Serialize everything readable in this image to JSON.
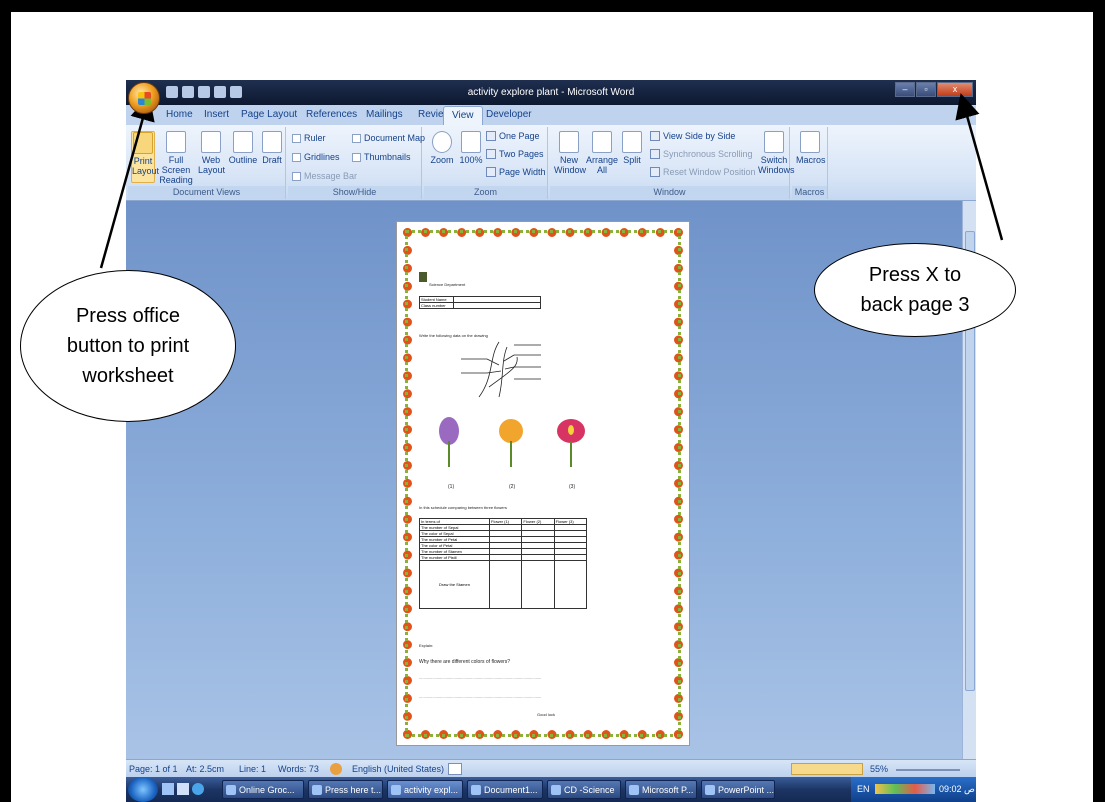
{
  "window": {
    "title": "activity explore plant - Microsoft Word",
    "controls": [
      "–",
      "▫",
      "x"
    ]
  },
  "tabs": [
    "Home",
    "Insert",
    "Page Layout",
    "References",
    "Mailings",
    "Review",
    "View",
    "Developer"
  ],
  "active_tab": "View",
  "ribbon": {
    "document_views": {
      "label": "Document Views",
      "print_layout": "Print Layout",
      "print": "Print",
      "layout": "Layout",
      "full_screen": "Full Screen",
      "reading": "Reading",
      "web": "Web",
      "web_layout": "Layout",
      "outline": "Outline",
      "draft": "Draft"
    },
    "show_hide": {
      "label": "Show/Hide",
      "ruler": "Ruler",
      "gridlines": "Gridlines",
      "message_bar": "Message Bar",
      "document_map": "Document Map",
      "thumbnails": "Thumbnails"
    },
    "zoom": {
      "label": "Zoom",
      "zoom": "Zoom",
      "hundred": "100%",
      "one_page": "One Page",
      "two_pages": "Two Pages",
      "page_width": "Page Width"
    },
    "window": {
      "label": "Window",
      "new_window": "New",
      "new_window2": "Window",
      "arrange": "Arrange",
      "arrange2": "All",
      "split": "Split",
      "view_side": "View Side by Side",
      "sync_scroll": "Synchronous Scrolling",
      "reset_pos": "Reset Window Position",
      "switch": "Switch",
      "switch2": "Windows"
    },
    "macros": {
      "label": "Macros",
      "macros": "Macros"
    }
  },
  "document": {
    "header": "Science Department",
    "student_name": "Student Name",
    "class_number": "Class number",
    "instruction": "Write the following data on the drawing",
    "flower_labels": [
      "(1)",
      "(2)",
      "(3)"
    ],
    "bullet": "In this schedule comparing between three flowers",
    "table_headers": [
      "In terms of",
      "Flower (1)",
      "Flower (2)",
      "Flower (3)"
    ],
    "table_rows": [
      "The number of Sepal",
      "The color of Sepal",
      "The number of Petal",
      "The color of Petal",
      "The number of Stamen",
      "The number of Pistil"
    ],
    "draw_row": "Draw the Stamen",
    "explain": "Explain:",
    "question": "Why there are different colors of flowers?",
    "line": "..............................................................................................................",
    "good_luck": "Good luck"
  },
  "statusbar": {
    "page": "Page: 1 of 1",
    "at": "At: 2.5cm",
    "line": "Line: 1",
    "words": "Words: 73",
    "language": "English (United States)",
    "zoom": "55%"
  },
  "taskbar": {
    "items": [
      "Online Groc...",
      "Press here t...",
      "activity expl...",
      "Document1...",
      "CD -Science",
      "Microsoft P...",
      "PowerPoint ..."
    ],
    "lang": "EN",
    "clock": "09:02 ص"
  },
  "callouts": {
    "left": "Press office button to print worksheet",
    "right": "Press X to back page 3"
  }
}
